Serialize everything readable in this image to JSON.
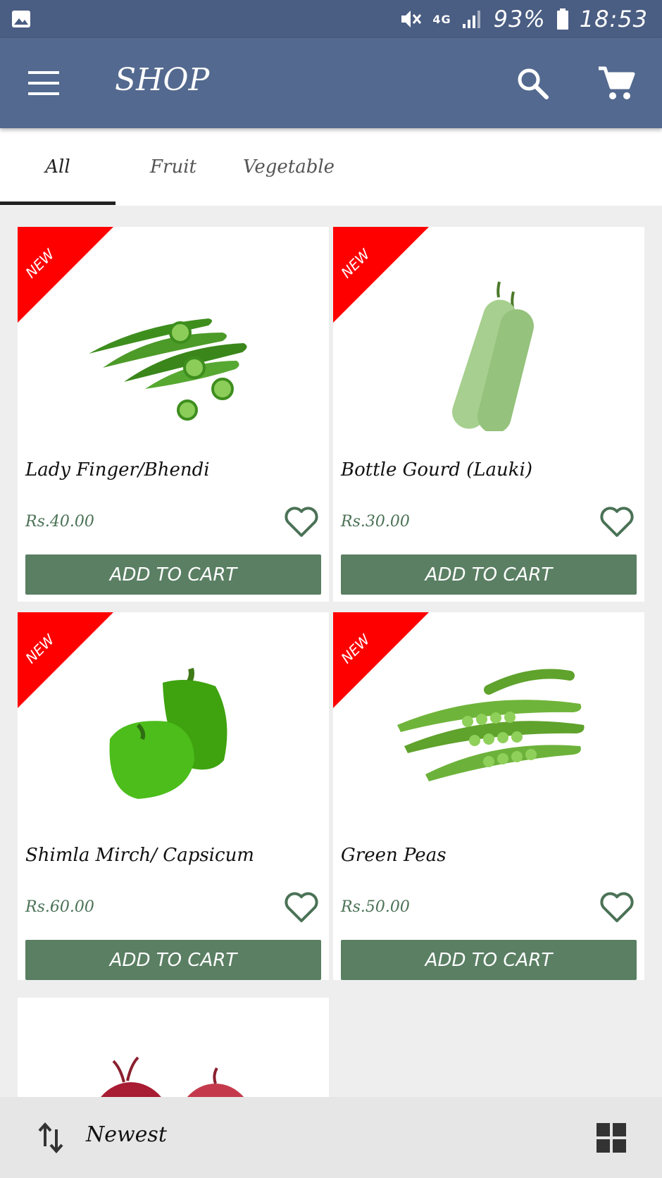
{
  "status_bar": {
    "battery": "93%",
    "time": "18:53",
    "network": "4G",
    "icons": [
      "image-icon",
      "mute-icon",
      "network-4g-icon",
      "signal-icon",
      "battery-icon"
    ]
  },
  "app_bar": {
    "title": "SHOP",
    "icons": [
      "menu-icon",
      "search-icon",
      "cart-icon"
    ]
  },
  "tabs": [
    {
      "label": "All",
      "active": true
    },
    {
      "label": "Fruit",
      "active": false
    },
    {
      "label": "Vegetable",
      "active": false
    }
  ],
  "products": [
    {
      "badge": "NEW",
      "name": "Lady Finger/Bhendi",
      "price": "Rs.40.00",
      "button": "ADD TO CART",
      "image": "okra"
    },
    {
      "badge": "NEW",
      "name": "Bottle Gourd (Lauki)",
      "price": "Rs.30.00",
      "button": "ADD TO CART",
      "image": "bottle-gourd"
    },
    {
      "badge": "NEW",
      "name": "Shimla Mirch/ Capsicum",
      "price": "Rs.60.00",
      "button": "ADD TO CART",
      "image": "capsicum"
    },
    {
      "badge": "NEW",
      "name": "Green Peas",
      "price": "Rs.50.00",
      "button": "ADD TO CART",
      "image": "green-peas"
    },
    {
      "image": "onion"
    }
  ],
  "bottom_bar": {
    "sort_label": "Newest",
    "icons": [
      "sort-icon",
      "grid-view-icon"
    ]
  },
  "colors": {
    "status_bar": "#4a5d82",
    "app_bar": "#53698f",
    "ribbon": "#ff0000",
    "button": "#5a7f63",
    "price": "#4b7256"
  }
}
